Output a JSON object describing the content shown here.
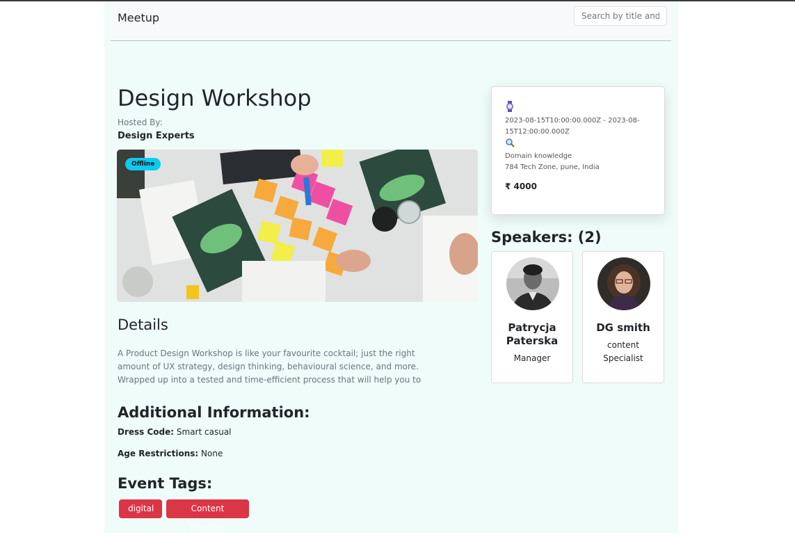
{
  "navbar": {
    "brand": "Meetup",
    "search_placeholder": "Search by title and"
  },
  "event": {
    "title": "Design Workshop",
    "hosted_by_label": "Hosted By:",
    "host": "Design Experts",
    "mode_badge": "Offline",
    "details_heading": "Details",
    "details_text": "A Product Design Workshop is like your favourite cocktail; just the right amount of UX strategy, design thinking, behavioural science, and more. Wrapped up into a tested and time-efficient process that will help you to",
    "additional_heading": "Additional Information:",
    "dress_code_label": "Dress Code:",
    "dress_code": "Smart casual",
    "age_label": "Age Restrictions:",
    "age": "None",
    "tags_heading": "Event Tags:",
    "tags": [
      "digital",
      "Content creation"
    ]
  },
  "info_card": {
    "time_icon": "watch-icon",
    "time_range": "2023-08-15T10:00:00.000Z - 2023-08-15T12:00:00.000Z",
    "location_icon": "magnifier-icon",
    "venue": "Domain knowledge",
    "address": "784 Tech Zone, pune, India",
    "price": "₹ 4000"
  },
  "speakers": {
    "heading": "Speakers: (2)",
    "items": [
      {
        "name": "Patrycja Paterska",
        "role": "Manager"
      },
      {
        "name": "DG smith",
        "role": "content Specialist"
      }
    ]
  },
  "colors": {
    "page_bg": "#effcf9",
    "tag_bg": "#dc3545",
    "badge_bg": "#0dcaf0"
  }
}
